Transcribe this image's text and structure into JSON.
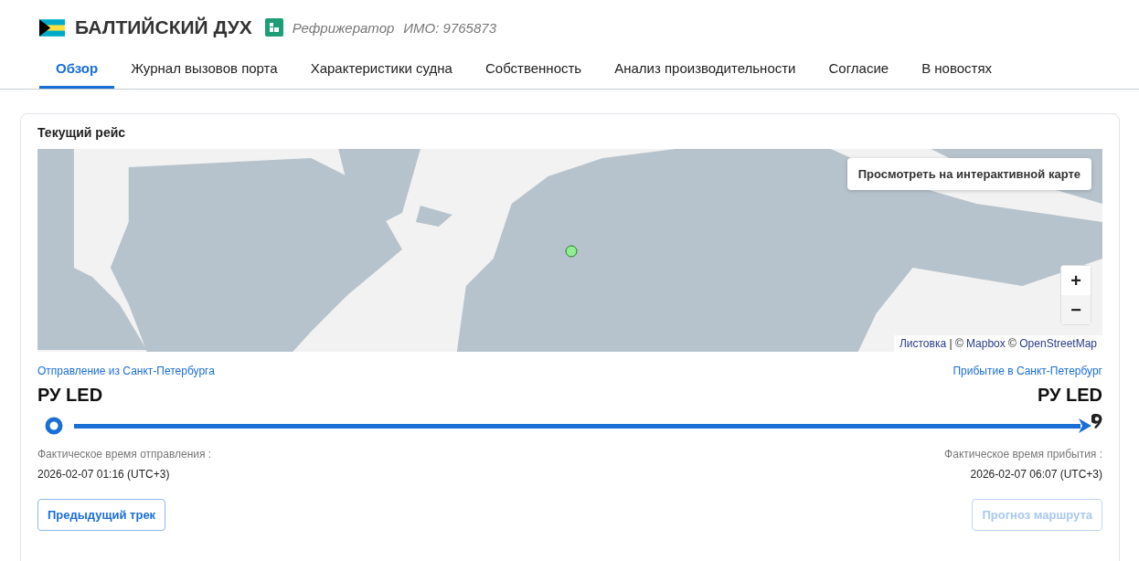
{
  "vessel": {
    "name": "БАЛТИЙСКИЙ ДУХ",
    "type": "Рефрижератор",
    "imo": "ИМО: 9765873"
  },
  "tabs": [
    {
      "label": "Обзор",
      "selected": true
    },
    {
      "label": "Журнал вызовов порта",
      "selected": false
    },
    {
      "label": "Характеристики судна",
      "selected": false
    },
    {
      "label": "Собственность",
      "selected": false
    },
    {
      "label": "Анализ производительности",
      "selected": false
    },
    {
      "label": "Согласие",
      "selected": false
    },
    {
      "label": "В новостях",
      "selected": false
    }
  ],
  "voyage": {
    "title": "Текущий рейс",
    "map": {
      "interactive_button": "Просмотреть на интерактивной карте",
      "zoom_in": "+",
      "zoom_out": "−",
      "attribution": [
        {
          "text": "Листовка",
          "link": true
        },
        {
          "text": " | © ",
          "link": false
        },
        {
          "text": "Mapbox",
          "link": true
        },
        {
          "text": " © ",
          "link": false
        },
        {
          "text": "OpenStreetMap",
          "link": true
        }
      ]
    },
    "departure": {
      "label": "Отправление из Санкт-Петербурга",
      "port": "РУ LED",
      "time_label": "Фактическое время отправления :",
      "time": "2026-02-07 01:16 (UTC+3)"
    },
    "arrival": {
      "label": "Прибытие в Санкт-Петербург",
      "port": "РУ LED",
      "time_label": "Фактическое время прибытия :",
      "time": "2026-02-07 06:07 (UTC+3)"
    },
    "buttons": [
      {
        "label": "Предыдущий трек",
        "disabled": false
      },
      {
        "label": "Прогноз маршрута",
        "disabled": true
      }
    ]
  }
}
